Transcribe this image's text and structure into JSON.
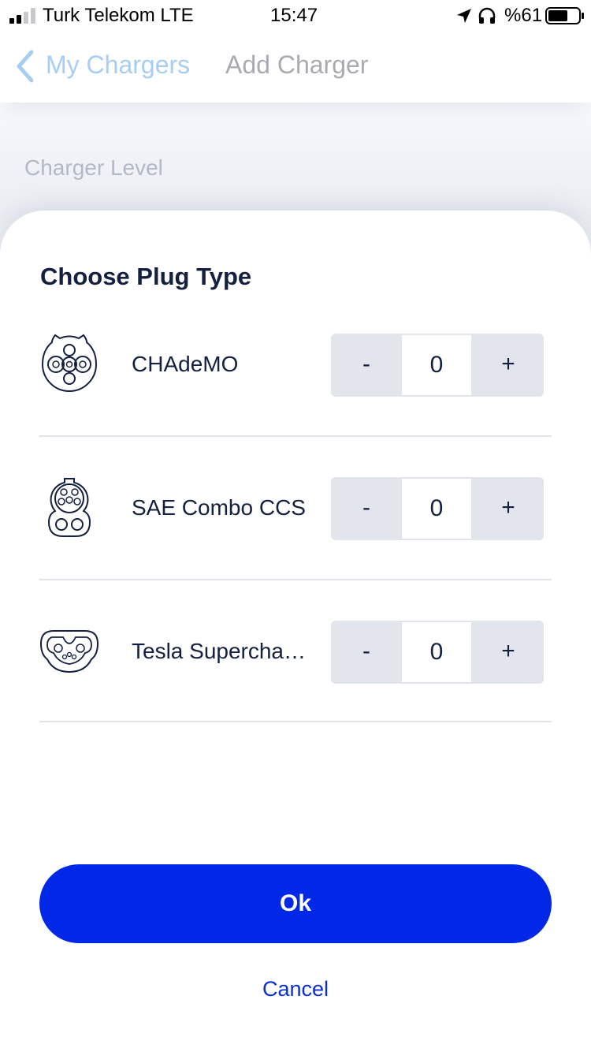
{
  "status_bar": {
    "carrier": "Turk Telekom  LTE",
    "time": "15:47",
    "battery_percent": "%61"
  },
  "nav": {
    "back_label": "My Chargers",
    "title": "Add Charger"
  },
  "background": {
    "section_label": "Charger Level"
  },
  "sheet": {
    "title": "Choose Plug Type",
    "plugs": [
      {
        "icon": "chademo-plug-icon",
        "name": "CHAdeMO",
        "minus": "-",
        "count": "0",
        "plus": "+"
      },
      {
        "icon": "ccs-combo-plug-icon",
        "name": "SAE Combo CCS",
        "minus": "-",
        "count": "0",
        "plus": "+"
      },
      {
        "icon": "tesla-plug-icon",
        "name": "Tesla Supercharger",
        "minus": "-",
        "count": "0",
        "plus": "+"
      }
    ],
    "ok_label": "Ok",
    "cancel_label": "Cancel"
  },
  "colors": {
    "primary": "#0028e6",
    "text_dark": "#14203f",
    "stepper_bg": "#e3e5ed",
    "back_link": "#a7cdf3"
  }
}
